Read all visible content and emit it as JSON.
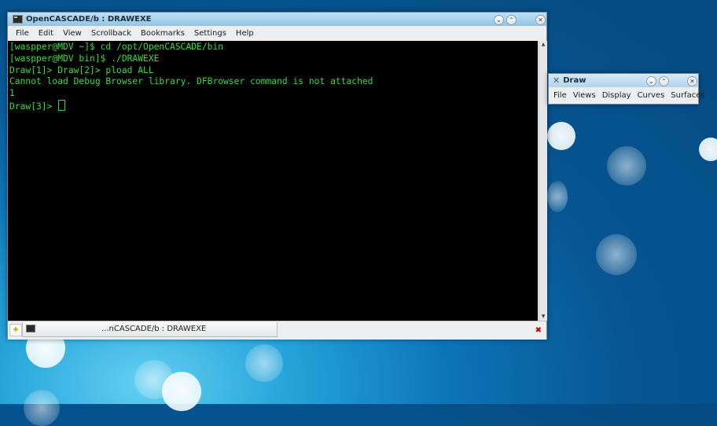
{
  "terminal_window": {
    "title": "OpenCASCADE/b : DRAWEXE",
    "buttons": {
      "minimize": "⌄",
      "maximize": "⌃",
      "close": "✕"
    },
    "menu": [
      "File",
      "Edit",
      "View",
      "Scrollback",
      "Bookmarks",
      "Settings",
      "Help"
    ],
    "lines": [
      "[waspper@MDV ~]$ cd /opt/OpenCASCADE/bin",
      "[waspper@MDV bin]$ ./DRAWEXE",
      "Draw[1]> Draw[2]> pload ALL",
      "Cannot load Debug Browser library. DFBrowser command is not attached",
      "1"
    ],
    "prompt": "Draw[3]> ",
    "tab_label": "...nCASCADE/b : DRAWEXE",
    "colors": {
      "terminal_bg": "#000000",
      "terminal_text": "#2fdc39"
    }
  },
  "draw_window": {
    "title": "Draw",
    "menu": [
      "File",
      "Views",
      "Display",
      "Curves",
      "Surfaces"
    ]
  }
}
